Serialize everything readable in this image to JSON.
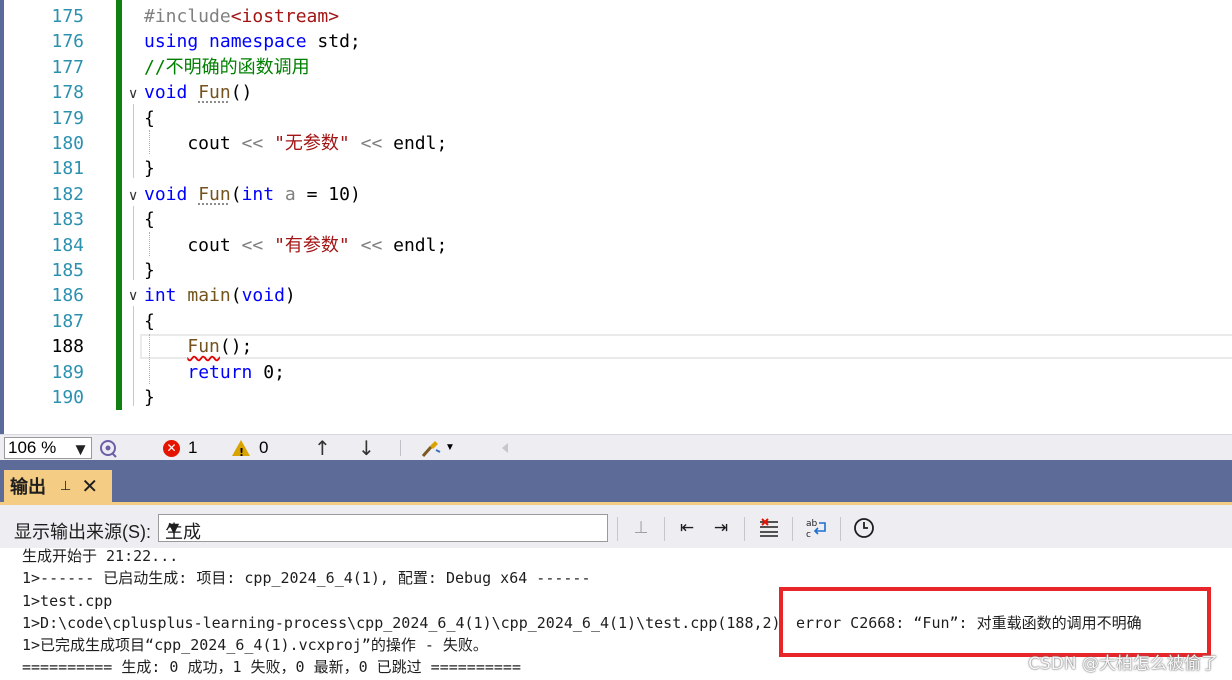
{
  "editor": {
    "lines": [
      {
        "num": "175",
        "tokens": [
          {
            "t": "#include",
            "c": "p"
          },
          {
            "t": "<iostream>",
            "c": "s"
          }
        ]
      },
      {
        "num": "176",
        "tokens": [
          {
            "t": "using",
            "c": "k"
          },
          {
            "t": " "
          },
          {
            "t": "namespace",
            "c": "k"
          },
          {
            "t": " std;"
          }
        ]
      },
      {
        "num": "177",
        "tokens": [
          {
            "t": "//不明确的函数调用",
            "c": "c"
          }
        ]
      },
      {
        "num": "178",
        "tokens": [
          {
            "t": "void",
            "c": "k"
          },
          {
            "t": " "
          },
          {
            "t": "Fun",
            "c": "f dots"
          },
          {
            "t": "()"
          }
        ]
      },
      {
        "num": "179",
        "tokens": [
          {
            "t": "{"
          }
        ]
      },
      {
        "num": "180",
        "tokens": [
          {
            "t": "    cout "
          },
          {
            "t": "<<",
            "c": "p"
          },
          {
            "t": " "
          },
          {
            "t": "\"无参数\"",
            "c": "s"
          },
          {
            "t": " "
          },
          {
            "t": "<<",
            "c": "p"
          },
          {
            "t": " endl;"
          }
        ]
      },
      {
        "num": "181",
        "tokens": [
          {
            "t": "}"
          }
        ]
      },
      {
        "num": "182",
        "tokens": [
          {
            "t": "void",
            "c": "k"
          },
          {
            "t": " "
          },
          {
            "t": "Fun",
            "c": "f dots"
          },
          {
            "t": "("
          },
          {
            "t": "int",
            "c": "k"
          },
          {
            "t": " "
          },
          {
            "t": "a",
            "c": "v"
          },
          {
            "t": " = 10)"
          }
        ]
      },
      {
        "num": "183",
        "tokens": [
          {
            "t": "{"
          }
        ]
      },
      {
        "num": "184",
        "tokens": [
          {
            "t": "    cout "
          },
          {
            "t": "<<",
            "c": "p"
          },
          {
            "t": " "
          },
          {
            "t": "\"有参数\"",
            "c": "s"
          },
          {
            "t": " "
          },
          {
            "t": "<<",
            "c": "p"
          },
          {
            "t": " endl;"
          }
        ]
      },
      {
        "num": "185",
        "tokens": [
          {
            "t": "}"
          }
        ]
      },
      {
        "num": "186",
        "tokens": [
          {
            "t": "int",
            "c": "k"
          },
          {
            "t": " "
          },
          {
            "t": "main",
            "c": "f"
          },
          {
            "t": "("
          },
          {
            "t": "void",
            "c": "k"
          },
          {
            "t": ")"
          }
        ]
      },
      {
        "num": "187",
        "tokens": [
          {
            "t": "{"
          }
        ]
      },
      {
        "num": "188",
        "tokens": [
          {
            "t": "    "
          },
          {
            "t": "Fun",
            "c": "f squig"
          },
          {
            "t": "();"
          }
        ]
      },
      {
        "num": "189",
        "tokens": [
          {
            "t": "    "
          },
          {
            "t": "return",
            "c": "k"
          },
          {
            "t": " 0;"
          }
        ]
      },
      {
        "num": "190",
        "tokens": [
          {
            "t": "}"
          }
        ]
      }
    ],
    "current_line": "188",
    "fold_glyph": "∨"
  },
  "status_bar": {
    "zoom": "106 %",
    "zoom_arrow": "▼",
    "error_count": "1",
    "warning_count": "0",
    "nav_up": "↑",
    "nav_down": "↓",
    "error_glyph": "✕"
  },
  "output_panel": {
    "tab_title": "输出",
    "pin_glyph": "⊥",
    "close_glyph": "✕",
    "source_label": "显示输出来源(S):",
    "source_value": "生成",
    "select_arrow": "▼",
    "toolbar_icons": {
      "find_message": "⊥",
      "prev_message": "⇤",
      "next_message": "⇥",
      "clear_all": "☰",
      "word_wrap": "⤶",
      "timestamp": "◷"
    },
    "lines": [
      "生成开始于 21:22...",
      "1>------ 已启动生成: 项目: cpp_2024_6_4(1), 配置: Debug x64 ------",
      "1>test.cpp",
      "1>D:\\code\\cplusplus-learning-process\\cpp_2024_6_4(1)\\cpp_2024_6_4(1)\\test.cpp(188,2)",
      "1>已完成生成项目“cpp_2024_6_4(1).vcxproj”的操作 - 失败。",
      "========== 生成: 0 成功，1 失败，0 最新，0 已跳过 =========="
    ],
    "error_text": "error C2668: “Fun”: 对重载函数的调用不明确"
  },
  "watermark": "CSDN @大柏怎么被偷了",
  "colors": {
    "keyword": "#0000ff",
    "string": "#a31515",
    "comment": "#008000",
    "change_bar": "#108010",
    "tab_active": "#f5cc84",
    "panel_header": "#5d6b99",
    "highlight": "#e8262a"
  }
}
